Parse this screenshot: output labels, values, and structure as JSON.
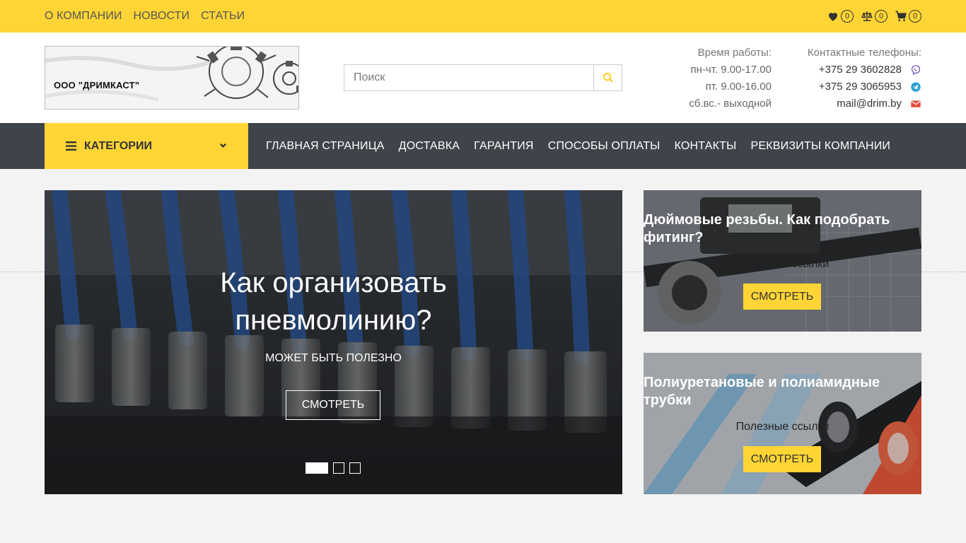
{
  "top_nav": {
    "items": [
      "О КОМПАНИИ",
      "НОВОСТИ",
      "СТАТЬИ"
    ]
  },
  "top_icons": {
    "favorites_count": "0",
    "compare_count": "0",
    "cart_count": "0"
  },
  "logo": {
    "text": "ООО \"ДРИМКАСТ\""
  },
  "search": {
    "placeholder": "Поиск"
  },
  "hours": {
    "title": "Время работы:",
    "lines": [
      "пн-чт. 9.00-17.00",
      "пт. 9.00-16.00",
      "сб.вс.- выходной"
    ]
  },
  "contacts": {
    "title": "Контактные телефоны:",
    "phone1": "+375 29 3602828",
    "phone2": "+375 29 3065953",
    "email": "mail@drim.by"
  },
  "main_nav": {
    "categories_label": "КАТЕГОРИИ",
    "items": [
      "ГЛАВНАЯ СТРАНИЦА",
      "ДОСТАВКА",
      "ГАРАНТИЯ",
      "СПОСОБЫ ОПЛАТЫ",
      "КОНТАКТЫ",
      "РЕКВИЗИТЫ КОМПАНИИ"
    ]
  },
  "slider": {
    "title_line1": "Как организовать",
    "title_line2": "пневмолинию?",
    "subtitle": "МОЖЕТ БЫТЬ ПОЛЕЗНО",
    "button": "СМОТРЕТЬ"
  },
  "banners": [
    {
      "title": "Дюймовые резьбы. Как подобрать фитинг?",
      "subtitle": "Полезные ссылки",
      "button": "СМОТРЕТЬ"
    },
    {
      "title": "Полиуретановые и полиамидные трубки",
      "subtitle": "Полезные ссылки",
      "button": "СМОТРЕТЬ"
    }
  ],
  "colors": {
    "accent_yellow": "#ffd535",
    "nav_dark": "#3e444a",
    "viber": "#7d5fc5",
    "telegram": "#2a9fd6",
    "email_red": "#e04a3f"
  }
}
